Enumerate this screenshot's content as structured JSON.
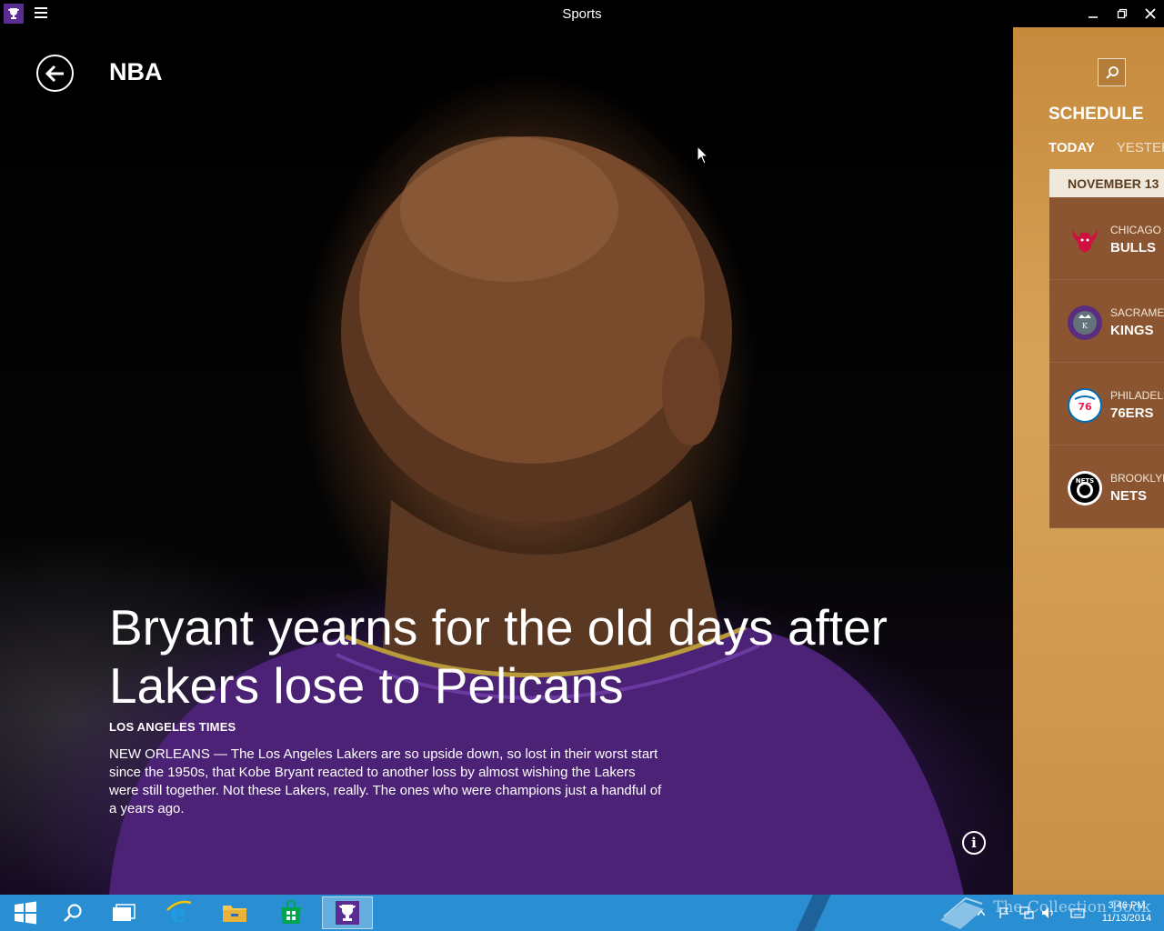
{
  "window": {
    "title": "Sports"
  },
  "hero": {
    "section": "NBA",
    "headline": "Bryant yearns for the old days after Lakers lose to Pelicans",
    "source": "LOS ANGELES TIMES",
    "summary": "NEW ORLEANS — The Los Angeles Lakers are so upside down, so lost in their worst start since the 1950s, that Kobe Bryant reacted to another loss by almost wishing the Lakers were still together. Not these Lakers, really. The ones who were champions just a handful of a years ago."
  },
  "schedule": {
    "title": "SCHEDULE",
    "tabs": [
      "TODAY",
      "YESTERDAY"
    ],
    "date": "NOVEMBER 13",
    "games": [
      {
        "city": "CHICAGO",
        "team": "BULLS",
        "icon": "bulls-logo-icon"
      },
      {
        "city": "SACRAMENTO",
        "team": "KINGS",
        "icon": "kings-logo-icon"
      },
      {
        "city": "PHILADELPHIA",
        "team": "76ERS",
        "icon": "76ers-logo-icon"
      },
      {
        "city": "BROOKLYN",
        "team": "NETS",
        "icon": "nets-logo-icon"
      }
    ]
  },
  "taskbar": {
    "apps": [
      "start-icon",
      "search-icon",
      "task-view-icon",
      "internet-explorer-icon",
      "file-explorer-icon",
      "store-icon",
      "sports-app-icon"
    ],
    "watermark": "The Collection Book",
    "time": "3:46 PM",
    "date": "11/13/2014"
  },
  "colors": {
    "panel": "#c58a3c",
    "game_card": "#8a5530",
    "taskbar": "#2a8fd2",
    "app_accent": "#5b2c91"
  }
}
